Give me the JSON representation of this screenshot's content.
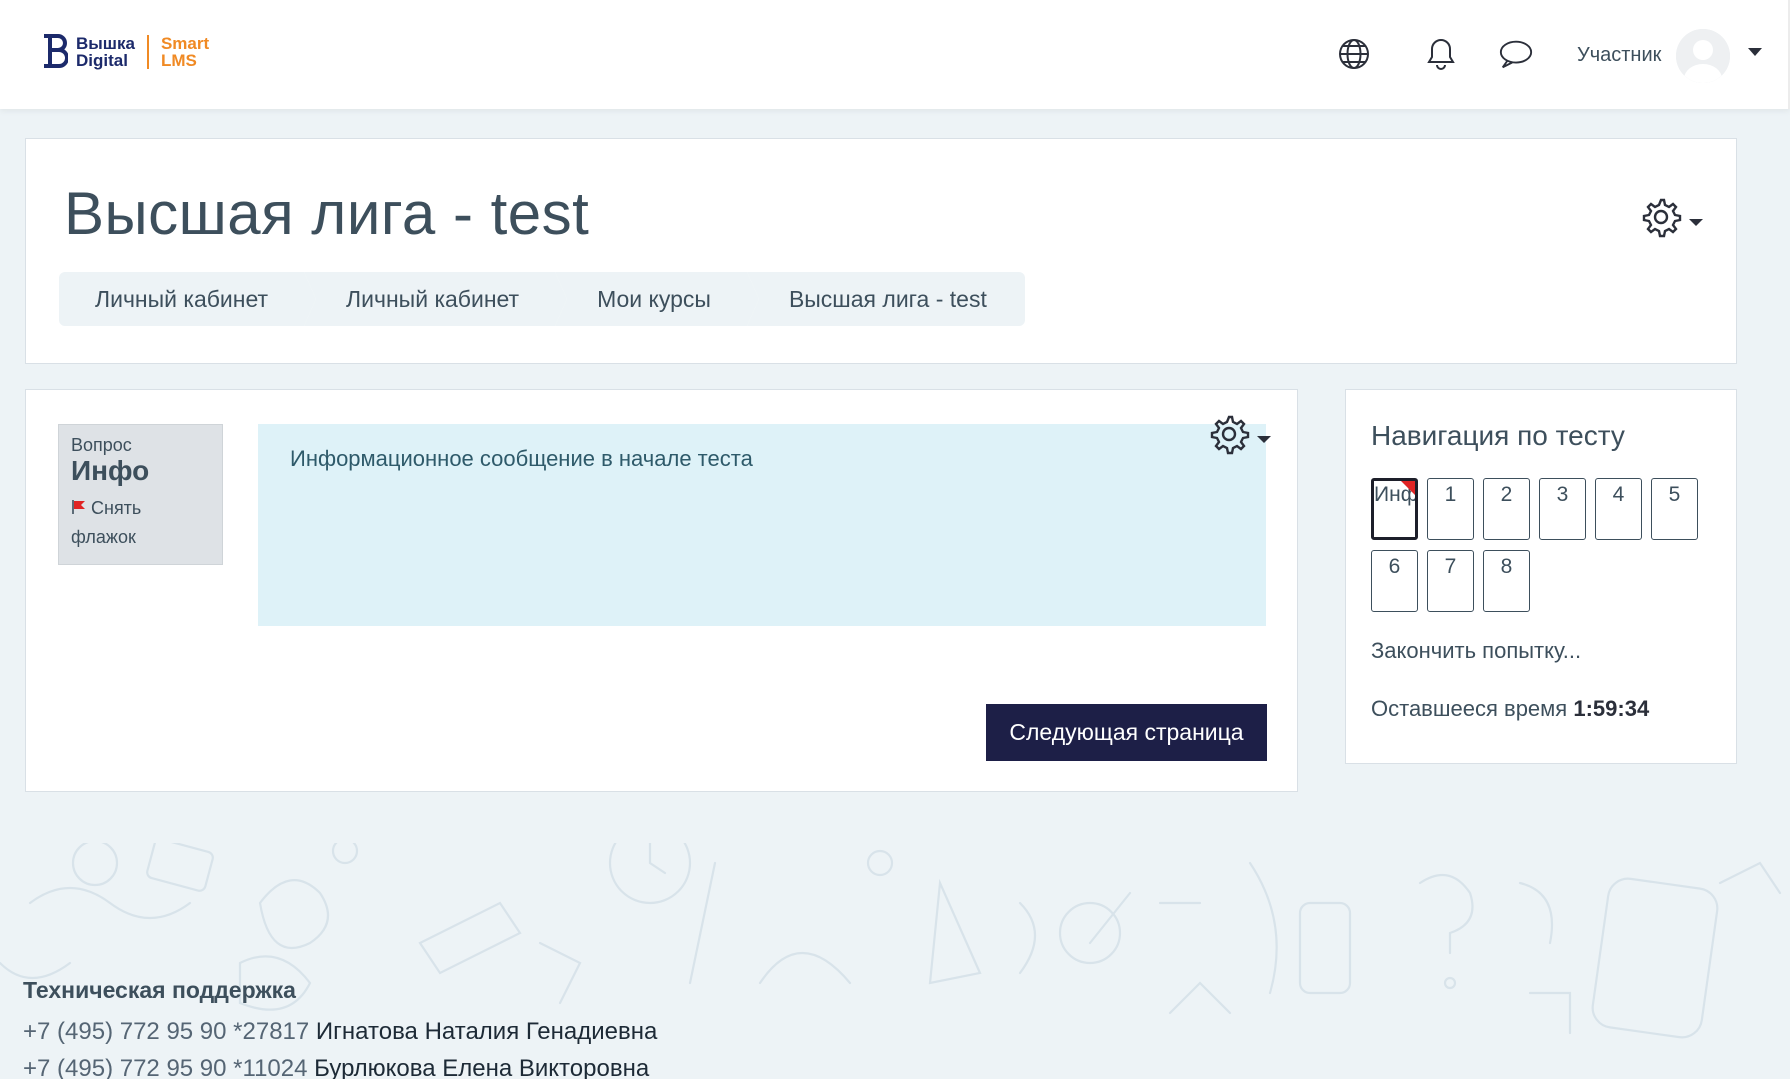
{
  "header": {
    "logo_line1": "Вышка",
    "logo_line2": "Digital",
    "logo_line3": "Smart",
    "logo_line4": "LMS",
    "user_name": "Участник",
    "icons": [
      "globe-icon",
      "bell-icon",
      "chat-icon",
      "avatar",
      "caret-down-icon"
    ]
  },
  "page": {
    "title": "Высшая лига - test",
    "breadcrumb": [
      "Личный кабинет",
      "Личный кабинет",
      "Мои курсы",
      "Высшая лига - test"
    ]
  },
  "question": {
    "label": "Вопрос",
    "number": "Инфо",
    "flag_label": "Снять флажок",
    "text": "Информационное сообщение в начале теста",
    "next_button": "Следующая страница"
  },
  "navigation": {
    "title": "Навигация по тесту",
    "buttons": [
      "Инф",
      "1",
      "2",
      "3",
      "4",
      "5",
      "6",
      "7",
      "8"
    ],
    "current_index": 0,
    "flagged_index": 0,
    "finish_link": "Закончить попытку...",
    "time_label": "Оставшееся время",
    "time_value": "1:59:34"
  },
  "footer": {
    "support_title": "Техническая поддержка",
    "contacts": [
      {
        "phone": "+7 (495) 772 95 90 *27817",
        "person": "Игнатова Наталия Генадиевна"
      },
      {
        "phone": "+7 (495) 772 95 90 *11024",
        "person": "Бурлюкова Елена Викторовна"
      }
    ]
  },
  "colors": {
    "accent_dark": "#1d1f47",
    "info_bg": "#def2f8",
    "page_bg": "#edf3f6",
    "brand_blue": "#1c2a6b",
    "brand_orange": "#f08a24",
    "flag_red": "#e02424"
  }
}
